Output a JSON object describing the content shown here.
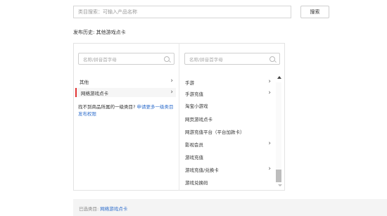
{
  "search": {
    "placeholder": "类目搜索：可输入产品名称",
    "button_label": "搜索"
  },
  "history": {
    "label": "发布历史:",
    "item": "其他游戏点卡"
  },
  "left_column": {
    "search_placeholder": "名称/拼音首字母",
    "items": [
      {
        "label": "其他",
        "has_children": true,
        "selected": false
      },
      {
        "label": "网络游戏点卡",
        "has_children": true,
        "selected": true
      }
    ],
    "hint_text": "找不到商品所属的一级类目?",
    "hint_link": "申请更多一级类目发布权限"
  },
  "right_column": {
    "search_placeholder": "名称/拼音首字母",
    "items": [
      {
        "label": "手游",
        "has_children": true
      },
      {
        "label": "手游充值",
        "has_children": true
      },
      {
        "label": "淘宝小游戏",
        "has_children": false
      },
      {
        "label": "网页游戏点卡",
        "has_children": false
      },
      {
        "label": "网游充值平台（平台加款卡）",
        "has_children": false
      },
      {
        "label": "影视会员",
        "has_children": true
      },
      {
        "label": "游戏充值",
        "has_children": false
      },
      {
        "label": "游戏充值/兑换卡",
        "has_children": true
      },
      {
        "label": "游戏兑换码",
        "has_children": false
      }
    ]
  },
  "selected": {
    "label": "已选类目:",
    "value": "网络游戏点卡"
  },
  "colors": {
    "accent_red": "#e23434",
    "link_blue": "#2f6ecc"
  },
  "icons": {
    "search": "search-icon",
    "chevron": "chevron-right-icon",
    "scroll_up": "scroll-up-arrow-icon",
    "scroll_down": "scroll-down-arrow-icon"
  }
}
